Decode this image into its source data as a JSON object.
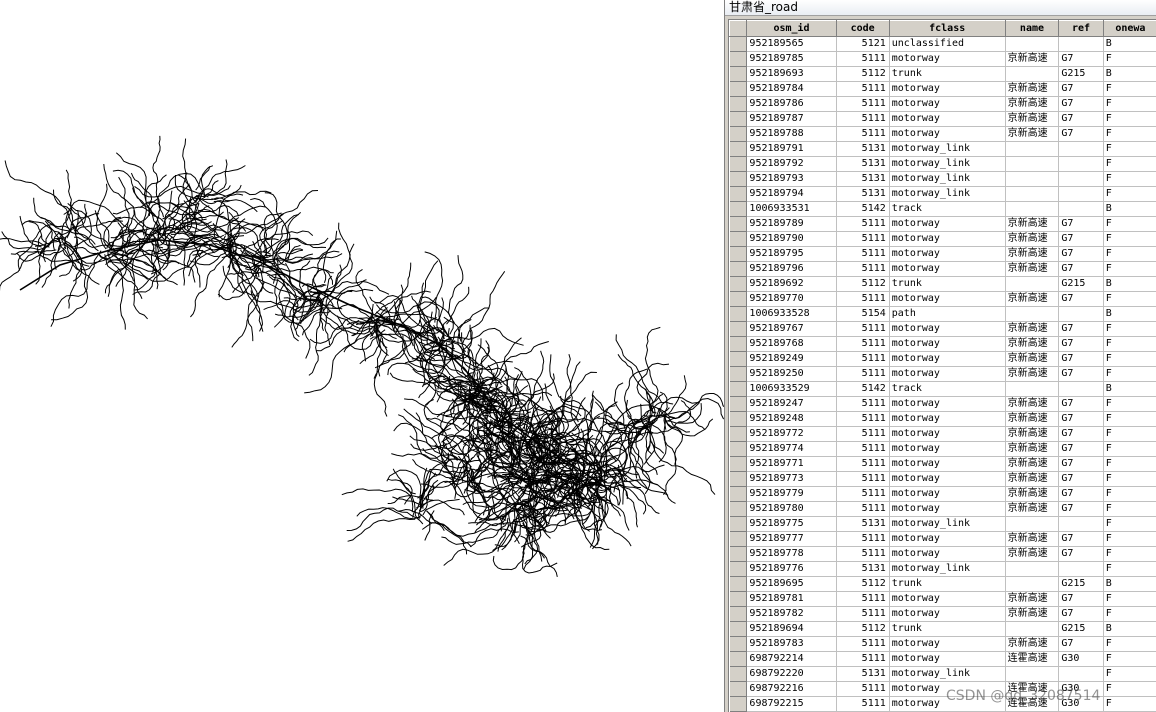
{
  "window": {
    "title": "甘肃省_road"
  },
  "table": {
    "columns": [
      "osm_id",
      "code",
      "fclass",
      "name",
      "ref",
      "onewa"
    ],
    "rows": [
      [
        "952189565",
        "5121",
        "unclassified",
        "",
        "",
        "B"
      ],
      [
        "952189785",
        "5111",
        "motorway",
        "京新高速",
        "G7",
        "F"
      ],
      [
        "952189693",
        "5112",
        "trunk",
        "",
        "G215",
        "B"
      ],
      [
        "952189784",
        "5111",
        "motorway",
        "京新高速",
        "G7",
        "F"
      ],
      [
        "952189786",
        "5111",
        "motorway",
        "京新高速",
        "G7",
        "F"
      ],
      [
        "952189787",
        "5111",
        "motorway",
        "京新高速",
        "G7",
        "F"
      ],
      [
        "952189788",
        "5111",
        "motorway",
        "京新高速",
        "G7",
        "F"
      ],
      [
        "952189791",
        "5131",
        "motorway_link",
        "",
        "",
        "F"
      ],
      [
        "952189792",
        "5131",
        "motorway_link",
        "",
        "",
        "F"
      ],
      [
        "952189793",
        "5131",
        "motorway_link",
        "",
        "",
        "F"
      ],
      [
        "952189794",
        "5131",
        "motorway_link",
        "",
        "",
        "F"
      ],
      [
        "1006933531",
        "5142",
        "track",
        "",
        "",
        "B"
      ],
      [
        "952189789",
        "5111",
        "motorway",
        "京新高速",
        "G7",
        "F"
      ],
      [
        "952189790",
        "5111",
        "motorway",
        "京新高速",
        "G7",
        "F"
      ],
      [
        "952189795",
        "5111",
        "motorway",
        "京新高速",
        "G7",
        "F"
      ],
      [
        "952189796",
        "5111",
        "motorway",
        "京新高速",
        "G7",
        "F"
      ],
      [
        "952189692",
        "5112",
        "trunk",
        "",
        "G215",
        "B"
      ],
      [
        "952189770",
        "5111",
        "motorway",
        "京新高速",
        "G7",
        "F"
      ],
      [
        "1006933528",
        "5154",
        "path",
        "",
        "",
        "B"
      ],
      [
        "952189767",
        "5111",
        "motorway",
        "京新高速",
        "G7",
        "F"
      ],
      [
        "952189768",
        "5111",
        "motorway",
        "京新高速",
        "G7",
        "F"
      ],
      [
        "952189249",
        "5111",
        "motorway",
        "京新高速",
        "G7",
        "F"
      ],
      [
        "952189250",
        "5111",
        "motorway",
        "京新高速",
        "G7",
        "F"
      ],
      [
        "1006933529",
        "5142",
        "track",
        "",
        "",
        "B"
      ],
      [
        "952189247",
        "5111",
        "motorway",
        "京新高速",
        "G7",
        "F"
      ],
      [
        "952189248",
        "5111",
        "motorway",
        "京新高速",
        "G7",
        "F"
      ],
      [
        "952189772",
        "5111",
        "motorway",
        "京新高速",
        "G7",
        "F"
      ],
      [
        "952189774",
        "5111",
        "motorway",
        "京新高速",
        "G7",
        "F"
      ],
      [
        "952189771",
        "5111",
        "motorway",
        "京新高速",
        "G7",
        "F"
      ],
      [
        "952189773",
        "5111",
        "motorway",
        "京新高速",
        "G7",
        "F"
      ],
      [
        "952189779",
        "5111",
        "motorway",
        "京新高速",
        "G7",
        "F"
      ],
      [
        "952189780",
        "5111",
        "motorway",
        "京新高速",
        "G7",
        "F"
      ],
      [
        "952189775",
        "5131",
        "motorway_link",
        "",
        "",
        "F"
      ],
      [
        "952189777",
        "5111",
        "motorway",
        "京新高速",
        "G7",
        "F"
      ],
      [
        "952189778",
        "5111",
        "motorway",
        "京新高速",
        "G7",
        "F"
      ],
      [
        "952189776",
        "5131",
        "motorway_link",
        "",
        "",
        "F"
      ],
      [
        "952189695",
        "5112",
        "trunk",
        "",
        "G215",
        "B"
      ],
      [
        "952189781",
        "5111",
        "motorway",
        "京新高速",
        "G7",
        "F"
      ],
      [
        "952189782",
        "5111",
        "motorway",
        "京新高速",
        "G7",
        "F"
      ],
      [
        "952189694",
        "5112",
        "trunk",
        "",
        "G215",
        "B"
      ],
      [
        "952189783",
        "5111",
        "motorway",
        "京新高速",
        "G7",
        "F"
      ],
      [
        "698792214",
        "5111",
        "motorway",
        "连霍高速",
        "G30",
        "F"
      ],
      [
        "698792220",
        "5131",
        "motorway_link",
        "",
        "",
        "F"
      ],
      [
        "698792216",
        "5111",
        "motorway",
        "连霍高速",
        "G30",
        "F"
      ],
      [
        "698792215",
        "5111",
        "motorway",
        "连霍高速",
        "G30",
        "F"
      ]
    ]
  },
  "watermark": {
    "text": "CSDN @qq_32087514"
  },
  "colors": {
    "road": "#000000",
    "grid_header": "#d4d0c8",
    "background": "#ffffff"
  }
}
